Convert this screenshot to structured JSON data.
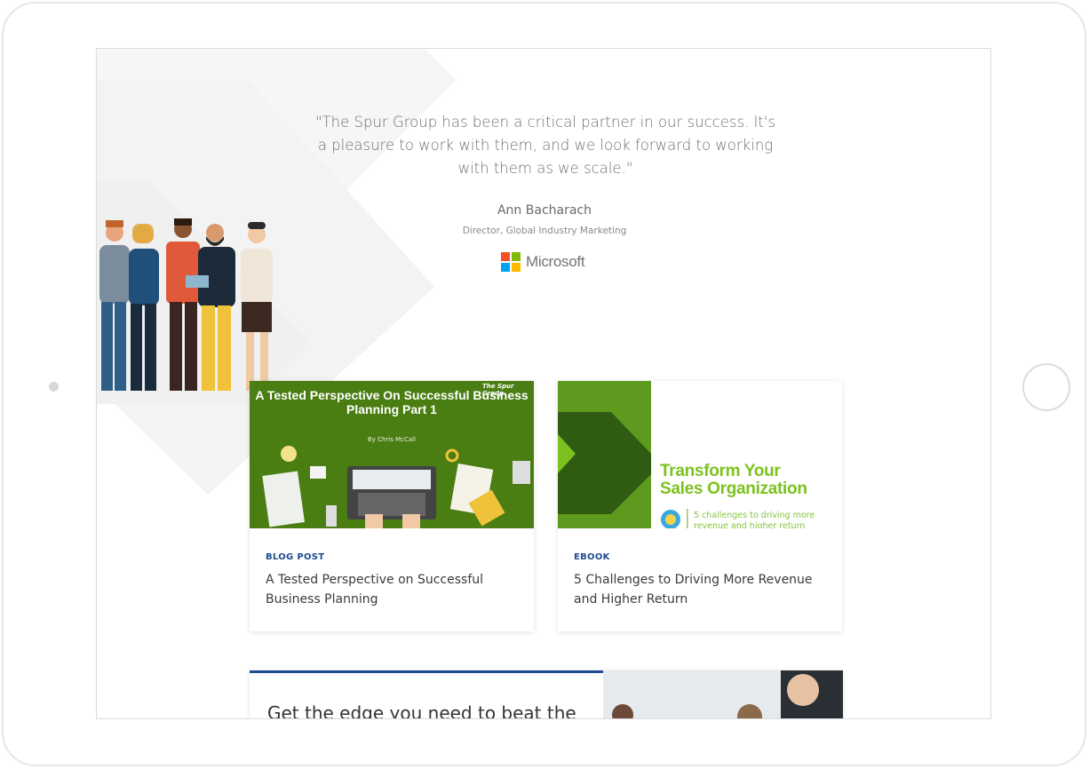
{
  "testimonial": {
    "quote": "\"The Spur Group has been a critical partner in our success. It's a pleasure to work with them, and we look forward to working with them as we scale.\"",
    "author_name": "Ann Bacharach",
    "author_title": "Director, Global Industry Marketing",
    "company_logo_text": "Microsoft"
  },
  "cards": [
    {
      "type": "BLOG POST",
      "title": "A Tested Perspective on Successful Business Planning",
      "image": {
        "title": "A Tested Perspective On Successful Business Planning Part 1",
        "byline": "By Chris McCall",
        "brand": "The Spur Group",
        "bg_color": "#4a7d12"
      }
    },
    {
      "type": "EBOOK",
      "title": "5 Challenges to Driving More Revenue and Higher Return",
      "image": {
        "title_line1": "Transform Your",
        "title_line2": "Sales Organization",
        "subtitle": "5 challenges to driving more revenue and higher return",
        "accent_color": "#7cc21e"
      }
    }
  ],
  "cta": {
    "text": "Get the edge you need to beat the"
  },
  "colors": {
    "accent_blue": "#1e4b8f",
    "microsoft": [
      "#f25022",
      "#7fba00",
      "#00a4ef",
      "#ffb900"
    ]
  }
}
